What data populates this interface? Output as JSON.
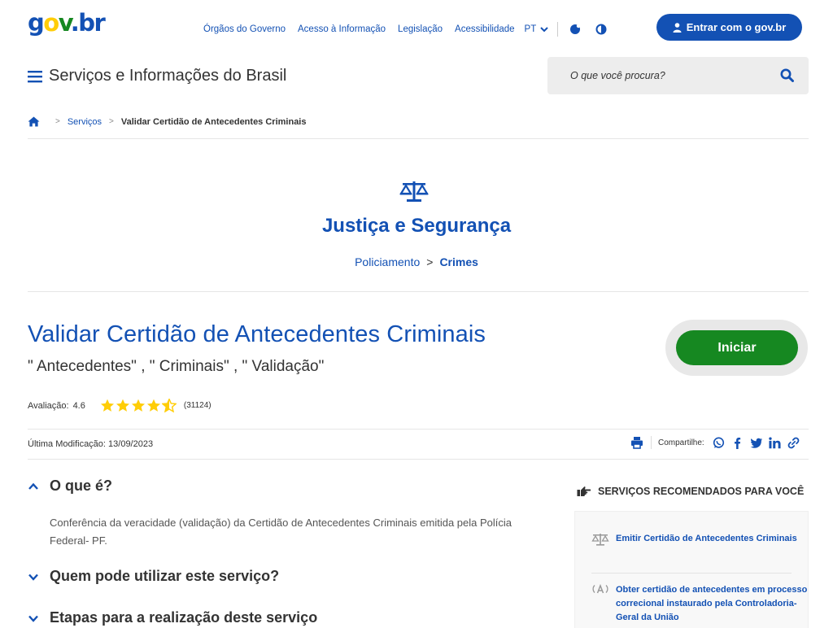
{
  "header": {
    "logo": {
      "g": "g",
      "o": "o",
      "v": "v",
      "dot": ".",
      "b": "b",
      "r": "r"
    },
    "links": [
      "Órgãos do Governo",
      "Acesso à Informação",
      "Legislação",
      "Acessibilidade"
    ],
    "language": "PT",
    "login_label": "Entrar com o gov.br",
    "site_title": "Serviços e Informações do Brasil",
    "search_placeholder": "O que você procura?"
  },
  "breadcrumb": {
    "sep": ">",
    "items": [
      "Serviços",
      "Validar Certidão de Antecedentes Criminais"
    ]
  },
  "category": {
    "title": "Justiça e Segurança",
    "sub_parent": "Policiamento",
    "sub_sep": ">",
    "sub_current": "Crimes"
  },
  "service": {
    "title": "Validar Certidão de Antecedentes Criminais",
    "tags": "\" Antecedentes\" , \" Criminais\" , \" Validação\"",
    "start_label": "Iniciar",
    "rating_label": "Avaliação:",
    "rating_value": "4.6",
    "rating_stars": 4.6,
    "rating_count": "(31124)",
    "modified": "Última Modificação: 13/09/2023",
    "share_label": "Compartilhe:"
  },
  "accordion": [
    {
      "title": "O que é?",
      "expanded": true,
      "body": "Conferência da veracidade (validação) da Certidão de Antecedentes Criminais emitida pela Polícia Federal- PF."
    },
    {
      "title": "Quem pode utilizar este serviço?",
      "expanded": false
    },
    {
      "title": "Etapas para a realização deste serviço",
      "expanded": false
    }
  ],
  "recommended": {
    "heading": "SERVIÇOS RECOMENDADOS PARA VOCÊ",
    "items": [
      {
        "label": "Emitir Certidão de Antecedentes Criminais",
        "icon": "scales-icon"
      },
      {
        "label": "Obter certidão de antecedentes em processo correcional instaurado pela Controladoria-Geral da União",
        "icon": "broadcast-icon"
      }
    ]
  },
  "colors": {
    "primary_blue": "#1351b4",
    "green": "#168821",
    "star": "#ffcd07",
    "search_bg": "#ededed"
  }
}
